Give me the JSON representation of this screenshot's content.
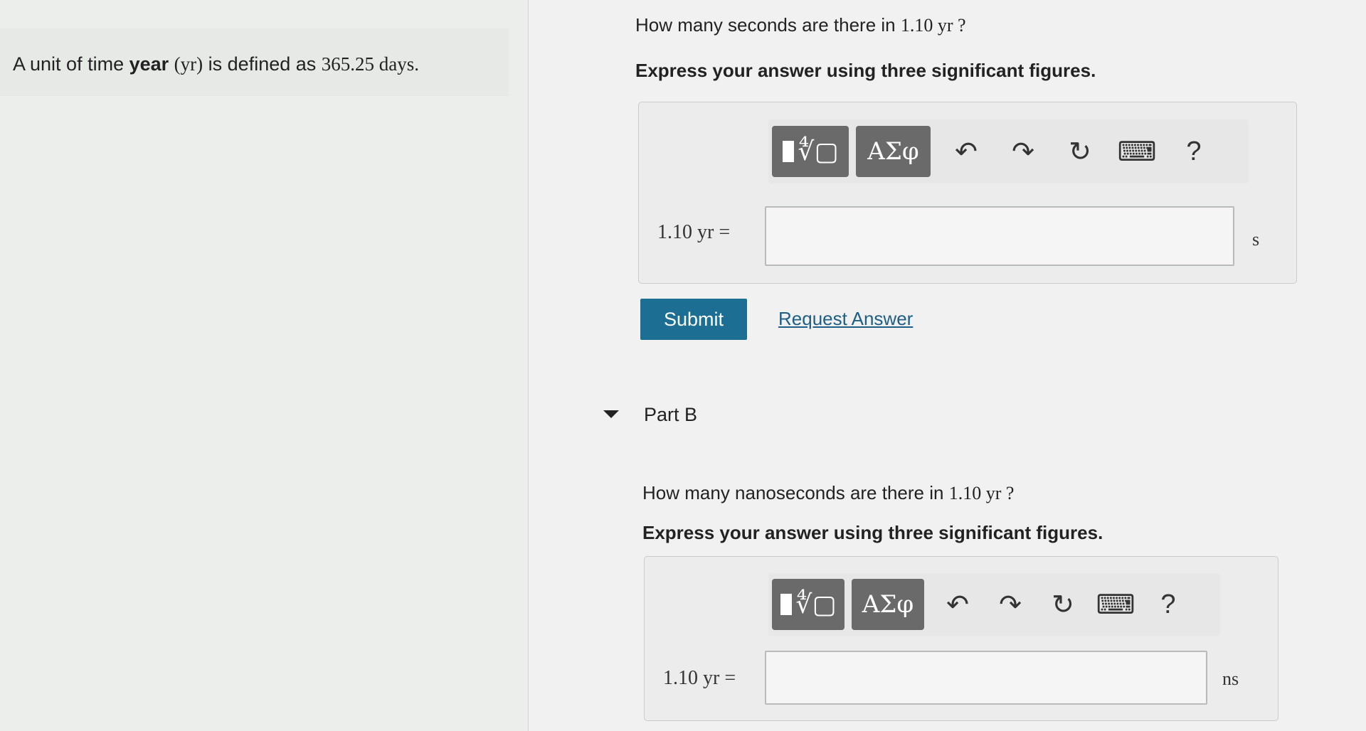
{
  "intro": {
    "prefix": "A unit of time ",
    "bold": "year",
    "symbol": "(yr)",
    "suffix": " is defined as ",
    "value": "365.25 days."
  },
  "partA": {
    "question_prefix": "How many seconds are there in ",
    "question_value": "1.10  yr ?",
    "instruction": "Express your answer using three significant figures.",
    "lhs": "1.10  yr =",
    "input_value": "",
    "unit": "s",
    "submit_label": "Submit",
    "request_label": "Request Answer"
  },
  "partB": {
    "title": "Part B",
    "question_prefix": "How many nanoseconds are there in ",
    "question_value": "1.10  yr ?",
    "instruction": "Express your answer using three significant figures.",
    "lhs": "1.10  yr =",
    "input_value": "",
    "unit": "ns"
  },
  "toolbar": {
    "symbols_label": "ΑΣφ",
    "help_label": "?"
  }
}
